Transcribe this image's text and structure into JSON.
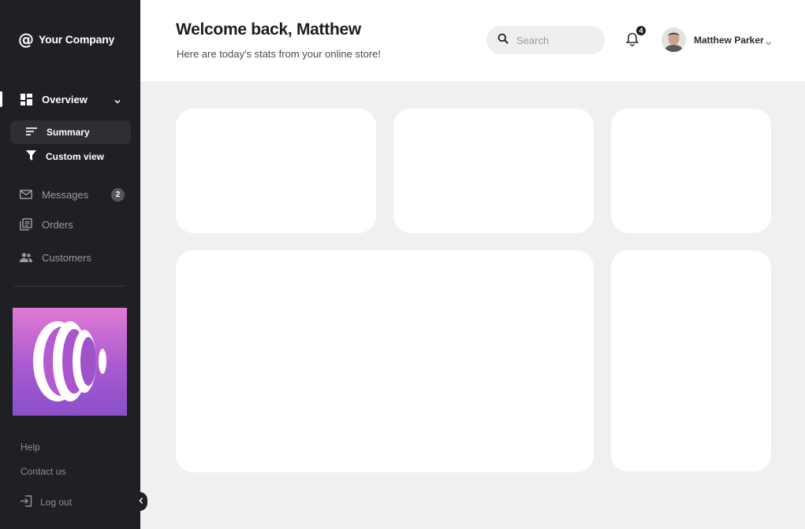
{
  "brand": {
    "name": "Your Company"
  },
  "sidebar": {
    "overview": {
      "label": "Overview"
    },
    "sub_items": [
      {
        "label": "Summary"
      },
      {
        "label": "Custom view"
      }
    ],
    "messages": {
      "label": "Messages",
      "badge": "2"
    },
    "orders": {
      "label": "Orders"
    },
    "customers": {
      "label": "Customers"
    },
    "footer": {
      "help": "Help",
      "contact": "Contact us",
      "logout": "Log out"
    }
  },
  "header": {
    "title": "Welcome back, Matthew",
    "subtitle": "Here are today's stats from your online store!",
    "search_placeholder": "Search",
    "notifications_count": "4",
    "user_name": "Matthew Parker"
  },
  "colors": {
    "sidebar_bg": "#1f2023",
    "page_bg": "#f0f0f0",
    "card_bg": "#ffffff",
    "promo_gradient_start": "#e07ad6",
    "promo_gradient_end": "#8a4fc9"
  }
}
